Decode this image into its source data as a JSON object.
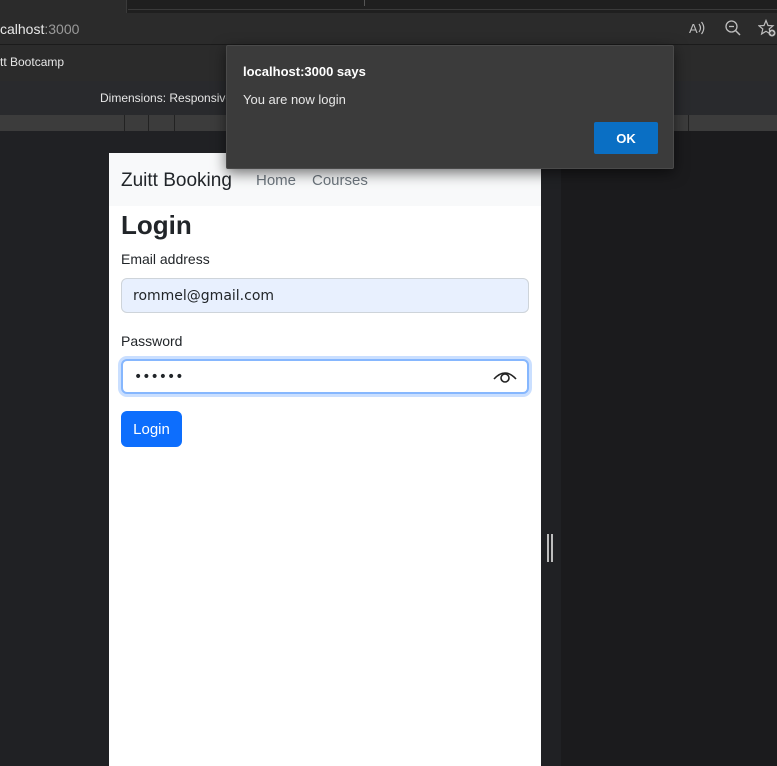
{
  "browser": {
    "url_host": "calhost",
    "url_port": ":3000",
    "favorite_label": "tt Bootcamp",
    "toolbar_icons": [
      "read-aloud-icon",
      "zoom-out-icon",
      "favorite-add-icon"
    ]
  },
  "devtools": {
    "dimensions_label": "Dimensions: Responsive"
  },
  "page": {
    "brand": "Zuitt Booking",
    "nav": {
      "home": "Home",
      "courses": "Courses"
    },
    "title": "Login",
    "email": {
      "label": "Email address",
      "value": "rommel@gmail.com"
    },
    "password": {
      "label": "Password",
      "value": "••••••"
    },
    "submit_label": "Login"
  },
  "dialog": {
    "title": "localhost:3000 says",
    "message": "You are now login",
    "ok_label": "OK"
  },
  "colors": {
    "primary": "#0d6efd",
    "dialog_ok": "#0a6fc4",
    "autofill_bg": "#e8f0fe",
    "focus_ring": "#86b7fe"
  }
}
